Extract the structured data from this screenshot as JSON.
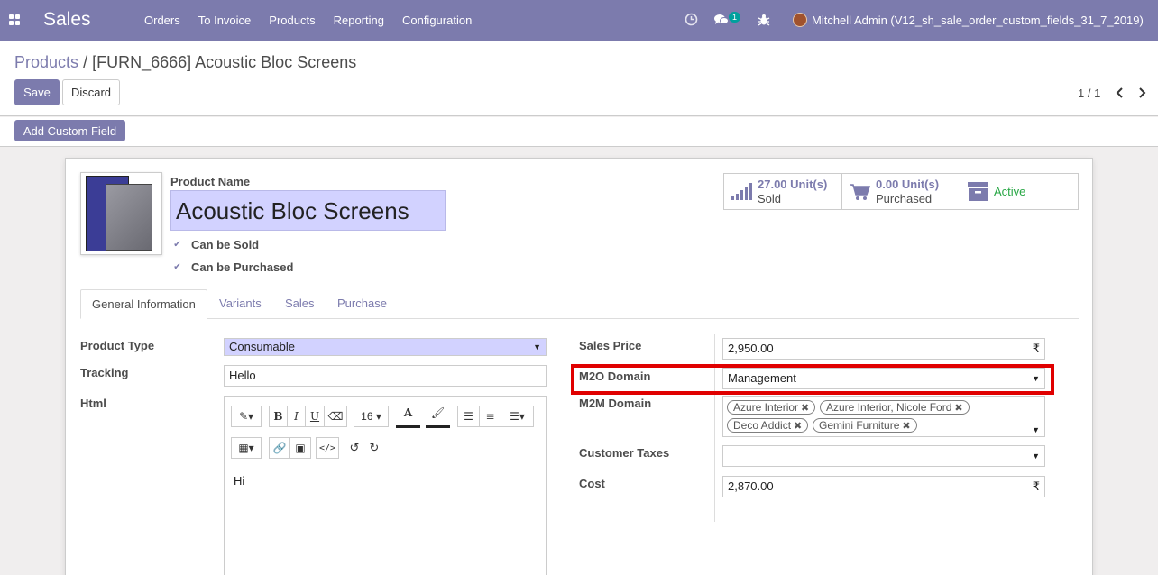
{
  "navbar": {
    "app_name": "Sales",
    "menu": [
      "Orders",
      "To Invoice",
      "Products",
      "Reporting",
      "Configuration"
    ],
    "chat_count": "1",
    "user": "Mitchell Admin (V12_sh_sale_order_custom_fields_31_7_2019)",
    "icons": {
      "apps": "apps-grid-icon",
      "activity": "clock-icon",
      "chat": "chat-bubbles-icon",
      "debug": "bug-icon"
    }
  },
  "breadcrumb": {
    "parent": "Products",
    "separator": "/",
    "current": "[FURN_6666] Acoustic Bloc Screens"
  },
  "buttons": {
    "save": "Save",
    "discard": "Discard",
    "add_custom_field": "Add Custom Field"
  },
  "pager": {
    "value": "1 / 1",
    "prev_icon": "chevron-left-icon",
    "next_icon": "chevron-right-icon"
  },
  "product": {
    "name_label": "Product Name",
    "name": "Acoustic Bloc Screens",
    "can_be_sold": "Can be Sold",
    "can_be_purchased": "Can be Purchased"
  },
  "stats": {
    "sold_value": "27.00 Unit(s)",
    "sold_label": "Sold",
    "purchased_value": "0.00 Unit(s)",
    "purchased_label": "Purchased",
    "active_label": "Active"
  },
  "tabs": [
    "General Information",
    "Variants",
    "Sales",
    "Purchase"
  ],
  "left_fields": {
    "product_type_label": "Product Type",
    "product_type": "Consumable",
    "tracking_label": "Tracking",
    "tracking": "Hello",
    "html_label": "Html",
    "html_content": "Hi",
    "font_size": "16"
  },
  "right_fields": {
    "sales_price_label": "Sales Price",
    "sales_price": "2,950.00",
    "currency": "₹",
    "m2o_label": "M2O Domain",
    "m2o_value": "Management",
    "m2m_label": "M2M Domain",
    "m2m_tags": [
      "Azure Interior",
      "Azure Interior, Nicole Ford",
      "Deco Addict",
      "Gemini Furniture"
    ],
    "taxes_label": "Customer Taxes",
    "cost_label": "Cost",
    "cost": "2,870.00"
  },
  "colors": {
    "brand": "#7c7bad",
    "highlight": "#e00000",
    "active": "#28a745"
  }
}
